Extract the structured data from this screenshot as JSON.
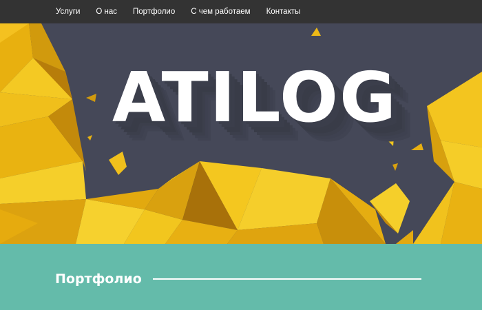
{
  "nav": {
    "items": [
      {
        "label": "Услуги"
      },
      {
        "label": "О нас"
      },
      {
        "label": "Портфолио"
      },
      {
        "label": "С чем работаем"
      },
      {
        "label": "Контакты"
      }
    ]
  },
  "hero": {
    "title": "ATILOG",
    "background_color": "#454858",
    "accent_color": "#f2c218"
  },
  "portfolio": {
    "heading": "Портфолио",
    "background_color": "#64bbaa"
  }
}
